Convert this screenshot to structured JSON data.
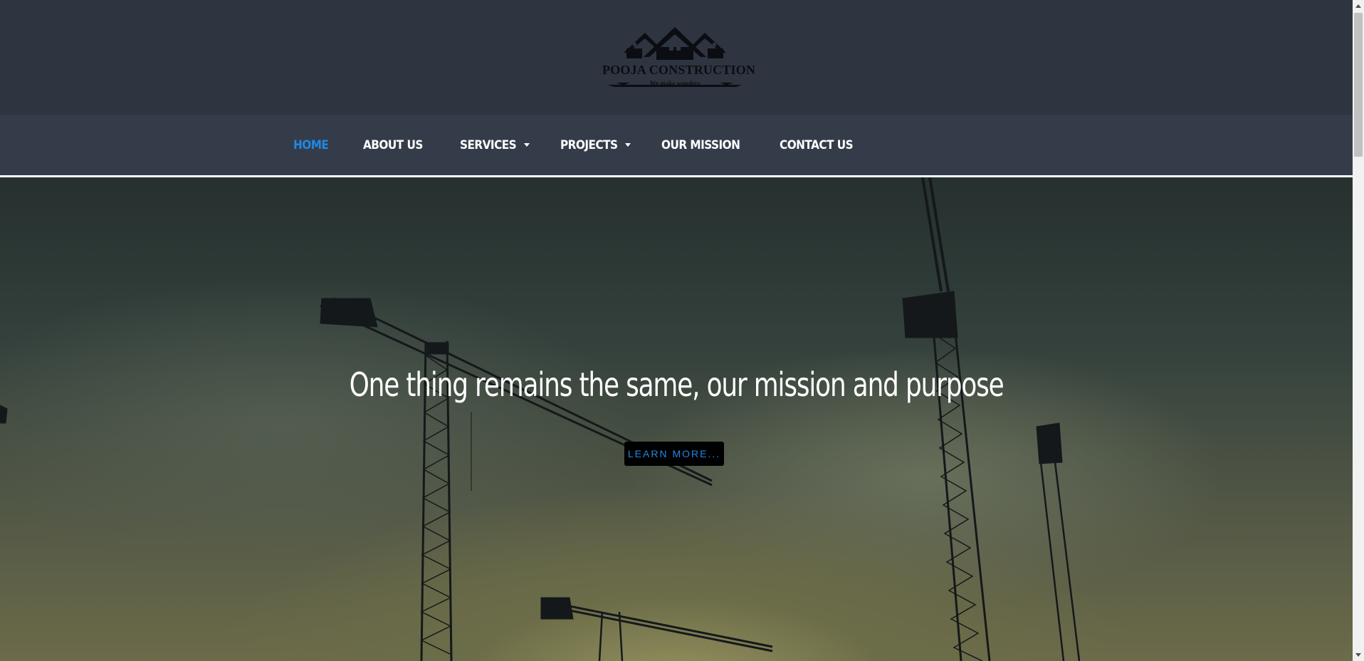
{
  "brand": {
    "name": "POOJA CONSTRUCTION",
    "tagline": "We make wonders",
    "logo_icon": "house-roofs-logo"
  },
  "nav": {
    "items": [
      {
        "label": "HOME",
        "active": true,
        "dropdown": false
      },
      {
        "label": "ABOUT US",
        "active": false,
        "dropdown": false
      },
      {
        "label": "SERVICES",
        "active": false,
        "dropdown": true
      },
      {
        "label": "PROJECTS",
        "active": false,
        "dropdown": true
      },
      {
        "label": "OUR MISSION",
        "active": false,
        "dropdown": false
      },
      {
        "label": "CONTACT US",
        "active": false,
        "dropdown": false
      }
    ]
  },
  "hero": {
    "title": "One thing remains the same, our mission and purpose",
    "button_label": "LEARN MORE..."
  },
  "colors": {
    "header_bg": "#2e3440",
    "nav_bg": "#353c49",
    "accent": "#1e88e5",
    "button_bg": "#000000"
  }
}
